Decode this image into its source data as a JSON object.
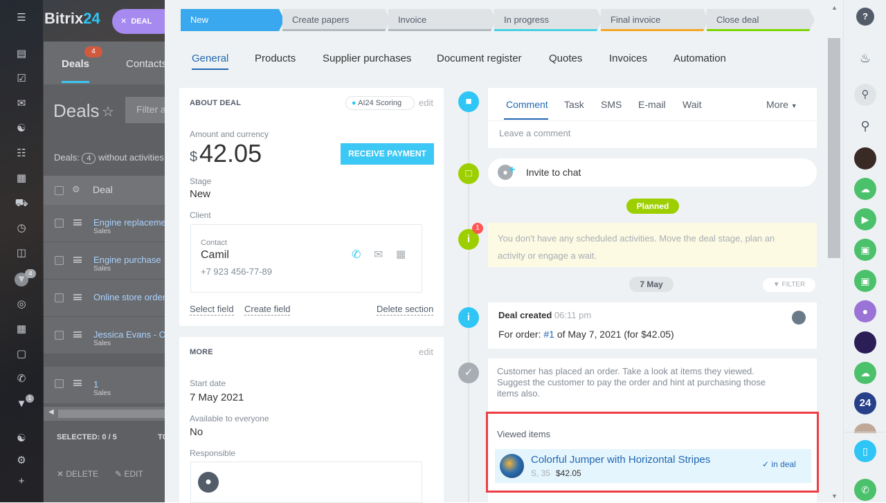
{
  "bg": {
    "logo_text": "Bitrix",
    "logo_num": "24",
    "deal_chip": "DEAL",
    "deals_tab": "Deals",
    "deals_badge": "4",
    "contacts_tab": "Contacts",
    "title": "Deals",
    "filter_placeholder": "Filter a",
    "counter_prefix": "Deals:",
    "counter_value": "4",
    "counter_suffix": "without activities",
    "col_deal": "Deal",
    "rows": [
      {
        "title": "Engine replacement",
        "sub": "Sales"
      },
      {
        "title": "Engine purchase",
        "sub": "Sales"
      },
      {
        "title": "Online store order",
        "sub": ""
      },
      {
        "title": "Jessica Evans - Online",
        "sub": "Sales"
      },
      {
        "title": "1",
        "sub": "Sales"
      }
    ],
    "selected": "SELECTED: 0 / 5",
    "total": "TO",
    "delete_btn": "DELETE",
    "edit_btn": "EDIT",
    "filter_badge": "4",
    "clock_badge": "1"
  },
  "stages": [
    {
      "label": "New",
      "color": "#39a8ef"
    },
    {
      "label": "Create papers",
      "color": "#b3b9bf"
    },
    {
      "label": "Invoice",
      "color": "#b3b9bf"
    },
    {
      "label": "In progress",
      "color": "#47d1e2"
    },
    {
      "label": "Final invoice",
      "color": "#f5a623"
    },
    {
      "label": "Close deal",
      "color": "#7bd500"
    }
  ],
  "tabs": [
    "General",
    "Products",
    "Supplier purchases",
    "Document register",
    "Quotes",
    "Invoices",
    "Automation"
  ],
  "about": {
    "title": "ABOUT DEAL",
    "scoring": "AI24 Scoring",
    "edit": "edit",
    "amount_label": "Amount and currency",
    "currency": "$",
    "amount": "42.05",
    "receive_payment": "RECEIVE PAYMENT",
    "stage_label": "Stage",
    "stage_value": "New",
    "client_label": "Client",
    "contact_label": "Contact",
    "contact_name": "Camil",
    "contact_phone": "+7 923 456-77-89",
    "select_field": "Select field",
    "create_field": "Create field",
    "delete_section": "Delete section"
  },
  "more": {
    "title": "MORE",
    "edit": "edit",
    "start_date_label": "Start date",
    "start_date": "7 May 2021",
    "available_label": "Available to everyone",
    "available": "No",
    "responsible_label": "Responsible"
  },
  "timeline": {
    "composer_tabs": [
      "Comment",
      "Task",
      "SMS",
      "E-mail",
      "Wait"
    ],
    "composer_more": "More",
    "comment_placeholder": "Leave a comment",
    "invite_chat": "Invite to chat",
    "planned": "Planned",
    "no_activities": "You don't have any scheduled activities. Move the deal stage, plan an activity or engage a wait.",
    "alert_badge": "1",
    "date_pill": "7 May",
    "filter": "FILTER",
    "deal_created": "Deal created",
    "deal_created_time": "06:11 pm",
    "order_prefix": "For order:",
    "order_link": "#1",
    "order_suffix": "of May 7, 2021 (for $42.05)",
    "customer_text": "Customer has placed an order. Take a look at items they viewed. Suggest the customer to pay the order and hint at purchasing those items also.",
    "viewed_title": "Viewed items",
    "item_name": "Colorful Jumper with Horizontal Stripes",
    "item_variant": "S, 35",
    "item_price": "$42.05",
    "item_status": "in deal"
  },
  "rail": {
    "help": "?",
    "badge_24": "24"
  }
}
